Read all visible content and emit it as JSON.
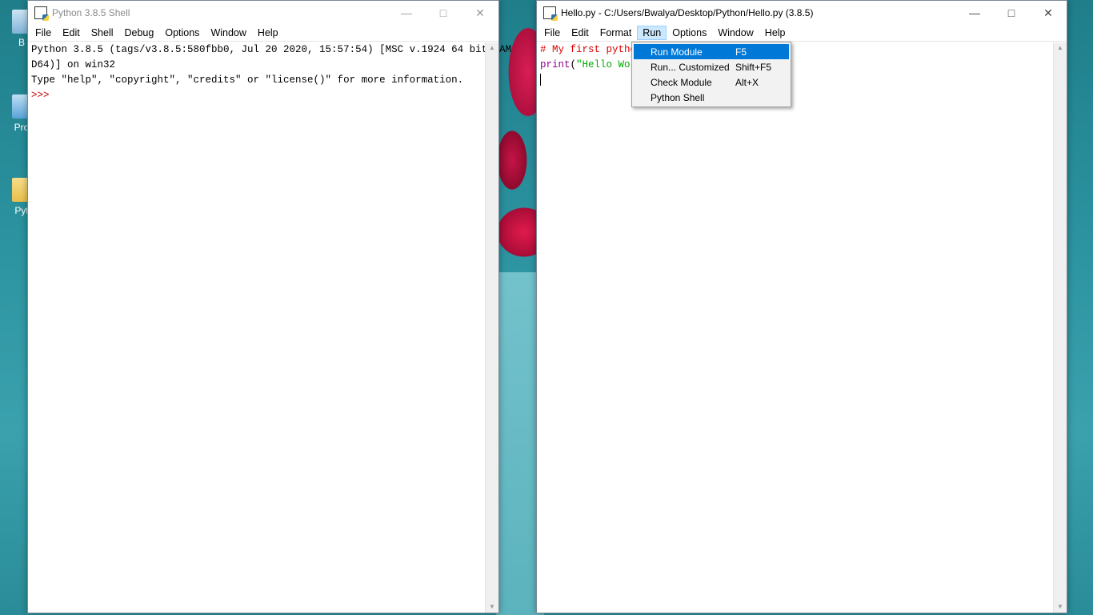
{
  "desktop": {
    "icons": [
      {
        "label": "B",
        "name": "recycle-bin"
      },
      {
        "label": "Pro",
        "name": "shortcut"
      },
      {
        "label": "Pyt",
        "name": "folder-python"
      }
    ]
  },
  "shell_window": {
    "title": "Python 3.8.5 Shell",
    "menu": [
      "File",
      "Edit",
      "Shell",
      "Debug",
      "Options",
      "Window",
      "Help"
    ],
    "lines": [
      "Python 3.8.5 (tags/v3.8.5:580fbb0, Jul 20 2020, 15:57:54) [MSC v.1924 64 bit (AM",
      "D64)] on win32",
      "Type \"help\", \"copyright\", \"credits\" or \"license()\" for more information."
    ],
    "prompt": ">>>"
  },
  "editor_window": {
    "title": "Hello.py - C:/Users/Bwalya/Desktop/Python/Hello.py (3.8.5)",
    "menu": [
      "File",
      "Edit",
      "Format",
      "Run",
      "Options",
      "Window",
      "Help"
    ],
    "open_menu": "Run",
    "code": {
      "comment": "# My first pytho",
      "builtin": "print",
      "paren_open": "(",
      "string": "\"Hello Wor"
    }
  },
  "run_menu": {
    "items": [
      {
        "label": "Run Module",
        "shortcut": "F5",
        "highlighted": true
      },
      {
        "label": "Run... Customized",
        "shortcut": "Shift+F5"
      },
      {
        "label": "Check Module",
        "shortcut": "Alt+X"
      },
      {
        "label": "Python Shell",
        "shortcut": ""
      }
    ]
  },
  "colors": {
    "highlight": "#0078d7",
    "comment": "#dd0000",
    "builtin": "#900090",
    "string": "#00aa00"
  }
}
